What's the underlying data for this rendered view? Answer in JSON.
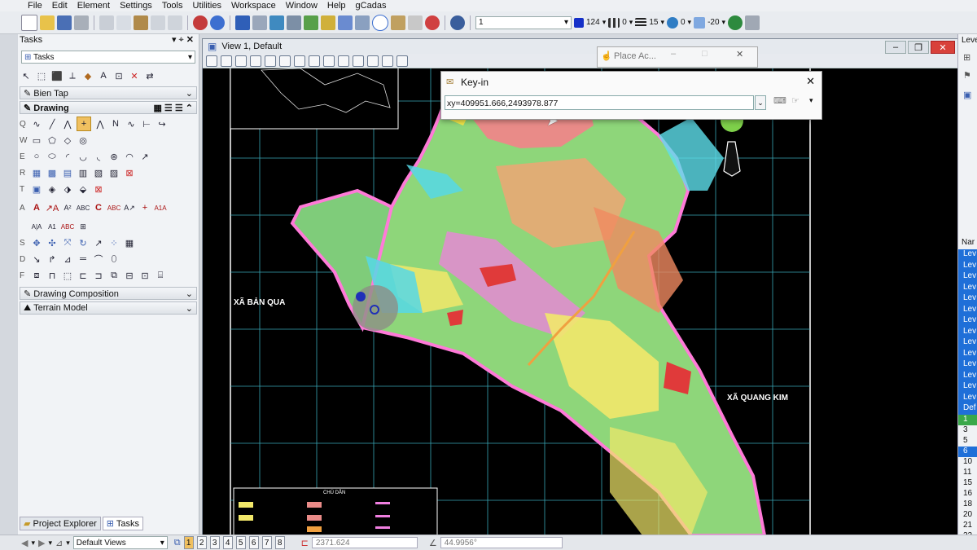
{
  "menu": [
    "File",
    "Edit",
    "Element",
    "Settings",
    "Tools",
    "Utilities",
    "Workspace",
    "Window",
    "Help",
    "gCadas"
  ],
  "toolbar": {
    "level_combo": "1",
    "color_value": "124",
    "linestyle_value": "0",
    "weight_value": "15",
    "transparency_value": "0",
    "priority_value": "-20",
    "colors": {
      "blue": "#1530c8"
    }
  },
  "tasks": {
    "title": "Tasks",
    "combo": "Tasks",
    "sections": {
      "bien_tap": "Bien Tap",
      "drawing": "Drawing",
      "drawing_composition": "Drawing Composition",
      "terrain_model": "Terrain Model"
    },
    "row_keys": [
      "Q",
      "W",
      "E",
      "R",
      "T",
      "A",
      "S",
      "D",
      "F"
    ],
    "tabs": {
      "project_explorer": "Project Explorer",
      "tasks": "Tasks"
    }
  },
  "view": {
    "title": "View 1, Default",
    "map_labels": {
      "left": "XÃ BẢN QUA",
      "right": "XÃ QUANG KIM"
    },
    "legend_title": "CHÚ DẪN"
  },
  "keyin": {
    "title": "Key-in",
    "value": "xy=409951.666,2493978.877"
  },
  "place_active": {
    "title": "Place Ac..."
  },
  "right_panel": {
    "header_fragment": "Leve",
    "name_col": "Nar",
    "rows_selected": [
      "Lev",
      "Lev",
      "Lev",
      "Lev",
      "Lev",
      "Lev",
      "Lev",
      "Lev",
      "Lev",
      "Lev",
      "Lev",
      "Lev",
      "Lev",
      "Lev"
    ],
    "row_def": "Def",
    "numbers": [
      "1",
      "3",
      "5",
      "6",
      "10",
      "11",
      "15",
      "16",
      "18",
      "20",
      "21",
      "22"
    ]
  },
  "status": {
    "default_views": "Default Views",
    "view_numbers": [
      "1",
      "2",
      "3",
      "4",
      "5",
      "6",
      "7",
      "8"
    ],
    "field_a": "2371.624",
    "field_b": "44.9956°"
  }
}
